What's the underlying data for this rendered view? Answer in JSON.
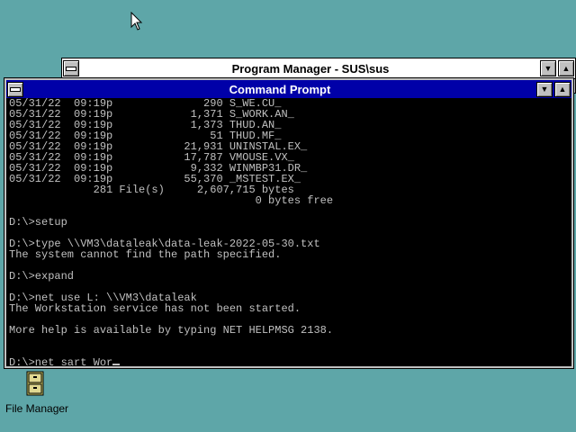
{
  "program_manager": {
    "title": "Program Manager - SUS\\sus"
  },
  "command_prompt": {
    "title": "Command Prompt",
    "lines": [
      "05/31/22  09:19p              290 S_WE.CU_",
      "05/31/22  09:19p            1,371 S_WORK.AN_",
      "05/31/22  09:19p            1,373 THUD.AN_",
      "05/31/22  09:19p               51 THUD.MF_",
      "05/31/22  09:19p           21,931 UNINSTAL.EX_",
      "05/31/22  09:19p           17,787 VMOUSE.VX_",
      "05/31/22  09:19p            9,332 WINMBP31.DR_",
      "05/31/22  09:19p           55,370 _MSTEST.EX_",
      "             281 File(s)     2,607,715 bytes",
      "                                      0 bytes free",
      "",
      "D:\\>setup",
      "",
      "D:\\>type \\\\VM3\\dataleak\\data-leak-2022-05-30.txt",
      "The system cannot find the path specified.",
      "",
      "D:\\>expand",
      "",
      "D:\\>net use L: \\\\VM3\\dataleak",
      "The Workstation service has not been started.",
      "",
      "More help is available by typing NET HELPMSG 2138.",
      "",
      ""
    ],
    "current_input": "D:\\>net sart Wor"
  },
  "desktop": {
    "file_manager_label": "File Manager"
  },
  "icons": {
    "cursor": "arrow-cursor-icon",
    "file_manager": "file-cabinet-icon"
  },
  "colors": {
    "desktop_bg": "#5ea6a8",
    "active_title_bg": "#0000a8",
    "console_bg": "#000000",
    "console_fg": "#c0c0c0"
  }
}
